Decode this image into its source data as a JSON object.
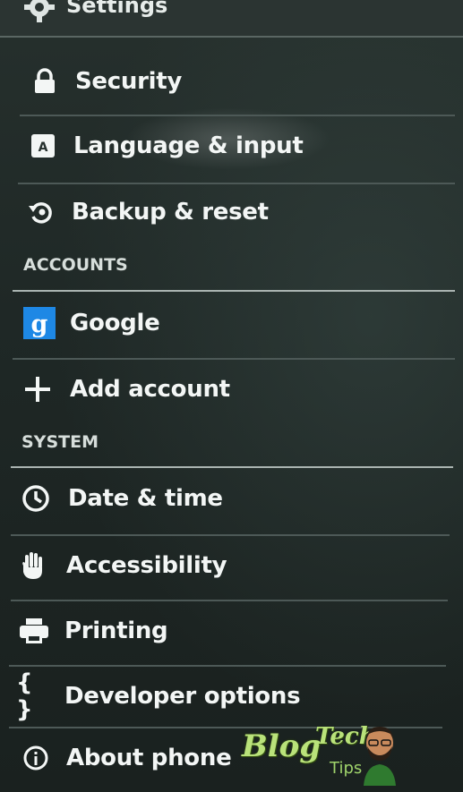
{
  "header": {
    "title": "Settings",
    "icon": "gear-icon"
  },
  "items_top": [
    {
      "label": "Security",
      "icon": "lock-icon"
    },
    {
      "label": "Language & input",
      "icon": "keyboard-a-icon"
    },
    {
      "label": "Backup & reset",
      "icon": "backup-restore-icon"
    }
  ],
  "sections": {
    "accounts": "ACCOUNTS",
    "system": "SYSTEM"
  },
  "accounts": [
    {
      "label": "Google",
      "icon": "google-g-icon"
    },
    {
      "label": "Add account",
      "icon": "plus-icon"
    }
  ],
  "system": [
    {
      "label": "Date & time",
      "icon": "clock-icon"
    },
    {
      "label": "Accessibility",
      "icon": "hand-icon"
    },
    {
      "label": "Printing",
      "icon": "printer-icon"
    },
    {
      "label": "Developer options",
      "icon": "braces-icon"
    },
    {
      "label": "About phone",
      "icon": "info-icon"
    }
  ],
  "watermark": {
    "blog": "Blog",
    "tech": "Tech",
    "tips": "Tips"
  },
  "colors": {
    "background": "#1c2422",
    "text": "#f3f6f5",
    "google_blue": "#1e88e5",
    "watermark_green": "#b9e27a"
  }
}
